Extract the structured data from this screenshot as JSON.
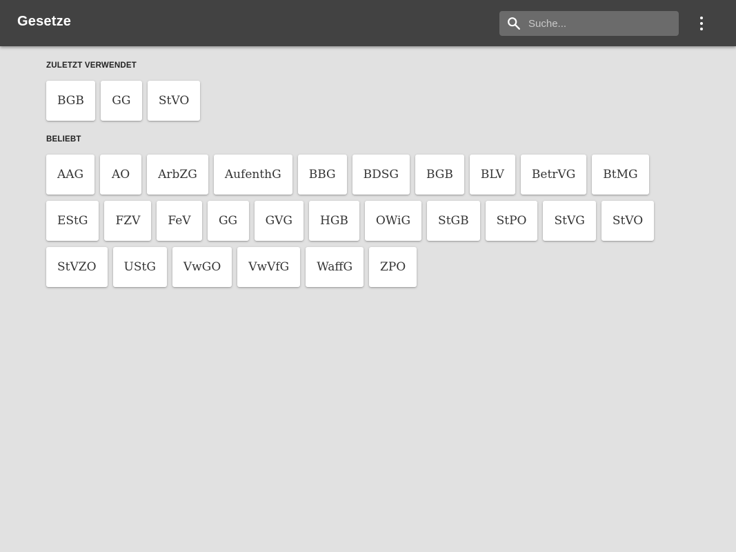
{
  "appbar": {
    "title": "Gesetze",
    "search_placeholder": "Suche...",
    "search_value": "",
    "menu_icon": "more-vert-icon"
  },
  "sections": {
    "recent": {
      "title": "ZULETZT VERWENDET",
      "items": [
        "BGB",
        "GG",
        "StVO"
      ]
    },
    "popular": {
      "title": "BELIEBT",
      "items": [
        "AAG",
        "AO",
        "ArbZG",
        "AufenthG",
        "BBG",
        "BDSG",
        "BGB",
        "BLV",
        "BetrVG",
        "BtMG",
        "EStG",
        "FZV",
        "FeV",
        "GG",
        "GVG",
        "HGB",
        "OWiG",
        "StGB",
        "StPO",
        "StVG",
        "StVO",
        "StVZO",
        "UStG",
        "VwGO",
        "VwVfG",
        "WaffG",
        "ZPO"
      ]
    }
  },
  "colors": {
    "appbar": "#424242",
    "background": "#e1e1e1",
    "card": "#ffffff"
  }
}
